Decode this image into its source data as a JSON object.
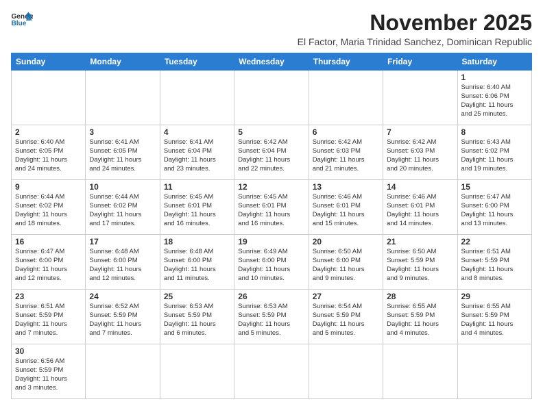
{
  "logo": {
    "line1": "General",
    "line2": "Blue"
  },
  "title": "November 2025",
  "subtitle": "El Factor, Maria Trinidad Sanchez, Dominican Republic",
  "weekdays": [
    "Sunday",
    "Monday",
    "Tuesday",
    "Wednesday",
    "Thursday",
    "Friday",
    "Saturday"
  ],
  "weeks": [
    [
      {
        "day": "",
        "info": ""
      },
      {
        "day": "",
        "info": ""
      },
      {
        "day": "",
        "info": ""
      },
      {
        "day": "",
        "info": ""
      },
      {
        "day": "",
        "info": ""
      },
      {
        "day": "",
        "info": ""
      },
      {
        "day": "1",
        "info": "Sunrise: 6:40 AM\nSunset: 6:06 PM\nDaylight: 11 hours\nand 25 minutes."
      }
    ],
    [
      {
        "day": "2",
        "info": "Sunrise: 6:40 AM\nSunset: 6:05 PM\nDaylight: 11 hours\nand 24 minutes."
      },
      {
        "day": "3",
        "info": "Sunrise: 6:41 AM\nSunset: 6:05 PM\nDaylight: 11 hours\nand 24 minutes."
      },
      {
        "day": "4",
        "info": "Sunrise: 6:41 AM\nSunset: 6:04 PM\nDaylight: 11 hours\nand 23 minutes."
      },
      {
        "day": "5",
        "info": "Sunrise: 6:42 AM\nSunset: 6:04 PM\nDaylight: 11 hours\nand 22 minutes."
      },
      {
        "day": "6",
        "info": "Sunrise: 6:42 AM\nSunset: 6:03 PM\nDaylight: 11 hours\nand 21 minutes."
      },
      {
        "day": "7",
        "info": "Sunrise: 6:42 AM\nSunset: 6:03 PM\nDaylight: 11 hours\nand 20 minutes."
      },
      {
        "day": "8",
        "info": "Sunrise: 6:43 AM\nSunset: 6:02 PM\nDaylight: 11 hours\nand 19 minutes."
      }
    ],
    [
      {
        "day": "9",
        "info": "Sunrise: 6:44 AM\nSunset: 6:02 PM\nDaylight: 11 hours\nand 18 minutes."
      },
      {
        "day": "10",
        "info": "Sunrise: 6:44 AM\nSunset: 6:02 PM\nDaylight: 11 hours\nand 17 minutes."
      },
      {
        "day": "11",
        "info": "Sunrise: 6:45 AM\nSunset: 6:01 PM\nDaylight: 11 hours\nand 16 minutes."
      },
      {
        "day": "12",
        "info": "Sunrise: 6:45 AM\nSunset: 6:01 PM\nDaylight: 11 hours\nand 16 minutes."
      },
      {
        "day": "13",
        "info": "Sunrise: 6:46 AM\nSunset: 6:01 PM\nDaylight: 11 hours\nand 15 minutes."
      },
      {
        "day": "14",
        "info": "Sunrise: 6:46 AM\nSunset: 6:01 PM\nDaylight: 11 hours\nand 14 minutes."
      },
      {
        "day": "15",
        "info": "Sunrise: 6:47 AM\nSunset: 6:00 PM\nDaylight: 11 hours\nand 13 minutes."
      }
    ],
    [
      {
        "day": "16",
        "info": "Sunrise: 6:47 AM\nSunset: 6:00 PM\nDaylight: 11 hours\nand 12 minutes."
      },
      {
        "day": "17",
        "info": "Sunrise: 6:48 AM\nSunset: 6:00 PM\nDaylight: 11 hours\nand 12 minutes."
      },
      {
        "day": "18",
        "info": "Sunrise: 6:48 AM\nSunset: 6:00 PM\nDaylight: 11 hours\nand 11 minutes."
      },
      {
        "day": "19",
        "info": "Sunrise: 6:49 AM\nSunset: 6:00 PM\nDaylight: 11 hours\nand 10 minutes."
      },
      {
        "day": "20",
        "info": "Sunrise: 6:50 AM\nSunset: 6:00 PM\nDaylight: 11 hours\nand 9 minutes."
      },
      {
        "day": "21",
        "info": "Sunrise: 6:50 AM\nSunset: 5:59 PM\nDaylight: 11 hours\nand 9 minutes."
      },
      {
        "day": "22",
        "info": "Sunrise: 6:51 AM\nSunset: 5:59 PM\nDaylight: 11 hours\nand 8 minutes."
      }
    ],
    [
      {
        "day": "23",
        "info": "Sunrise: 6:51 AM\nSunset: 5:59 PM\nDaylight: 11 hours\nand 7 minutes."
      },
      {
        "day": "24",
        "info": "Sunrise: 6:52 AM\nSunset: 5:59 PM\nDaylight: 11 hours\nand 7 minutes."
      },
      {
        "day": "25",
        "info": "Sunrise: 6:53 AM\nSunset: 5:59 PM\nDaylight: 11 hours\nand 6 minutes."
      },
      {
        "day": "26",
        "info": "Sunrise: 6:53 AM\nSunset: 5:59 PM\nDaylight: 11 hours\nand 5 minutes."
      },
      {
        "day": "27",
        "info": "Sunrise: 6:54 AM\nSunset: 5:59 PM\nDaylight: 11 hours\nand 5 minutes."
      },
      {
        "day": "28",
        "info": "Sunrise: 6:55 AM\nSunset: 5:59 PM\nDaylight: 11 hours\nand 4 minutes."
      },
      {
        "day": "29",
        "info": "Sunrise: 6:55 AM\nSunset: 5:59 PM\nDaylight: 11 hours\nand 4 minutes."
      }
    ],
    [
      {
        "day": "30",
        "info": "Sunrise: 6:56 AM\nSunset: 5:59 PM\nDaylight: 11 hours\nand 3 minutes."
      },
      {
        "day": "",
        "info": ""
      },
      {
        "day": "",
        "info": ""
      },
      {
        "day": "",
        "info": ""
      },
      {
        "day": "",
        "info": ""
      },
      {
        "day": "",
        "info": ""
      },
      {
        "day": "",
        "info": ""
      }
    ]
  ]
}
